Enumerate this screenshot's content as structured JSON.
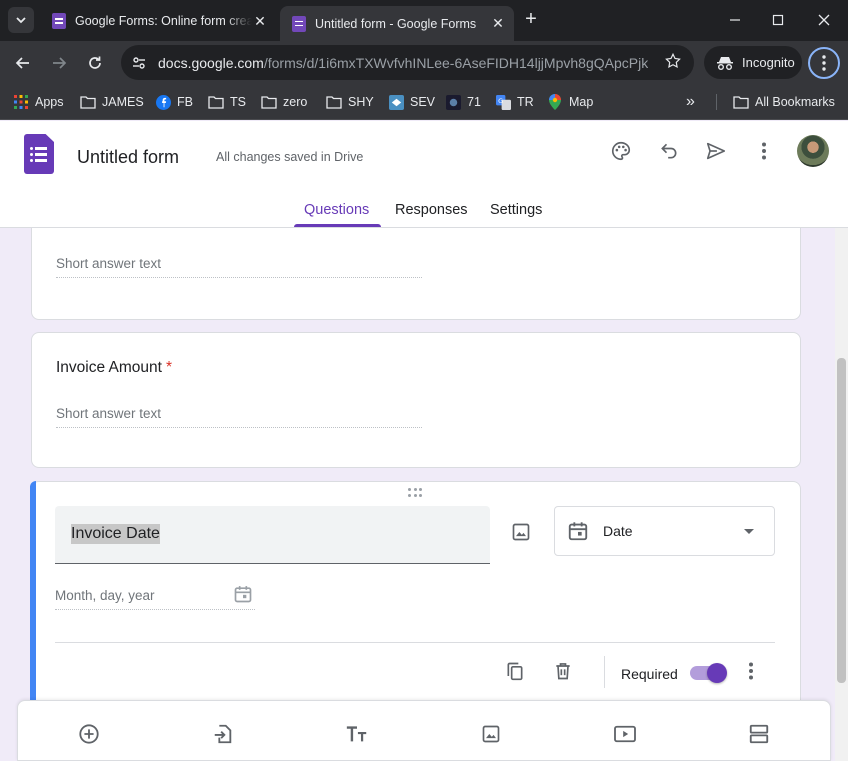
{
  "browser": {
    "tabs": [
      {
        "title": "Google Forms: Online form crea",
        "active": false
      },
      {
        "title": "Untitled form - Google Forms",
        "active": true
      }
    ],
    "url_domain": "docs.google.com",
    "url_path": "/forms/d/1i6mxTXWvfvhINLee-6AseFIDH14ljjMpvh8gQApcPjk...",
    "incognito_label": "Incognito",
    "bookmarks": [
      "Apps",
      "JAMES",
      "FB",
      "TS",
      "zero",
      "SHY",
      "SEV",
      "71",
      "TR",
      "Map"
    ],
    "all_bookmarks": "All Bookmarks",
    "more_bookmarks": "»"
  },
  "form": {
    "title": "Untitled form",
    "save_status": "All changes saved in Drive",
    "nav_tabs": [
      "Questions",
      "Responses",
      "Settings"
    ],
    "active_tab": "Questions",
    "accent_color": "#673ab7"
  },
  "questions": {
    "q_prev": {
      "placeholder": "Short answer text"
    },
    "q_amount": {
      "title": "Invoice Amount",
      "required_mark": "*",
      "placeholder": "Short answer text"
    },
    "q_date": {
      "title": "Invoice Date",
      "type": "Date",
      "placeholder": "Month, day, year",
      "required_label": "Required",
      "required": true
    }
  },
  "icons": {
    "tab_search": "chevron-down-icon",
    "back": "back-arrow-icon",
    "forward": "forward-arrow-icon",
    "reload": "reload-icon",
    "site_info": "tune-icon",
    "star": "star-icon",
    "palette": "palette-icon",
    "undo": "undo-icon",
    "send": "send-icon",
    "more": "more-vert-icon"
  }
}
